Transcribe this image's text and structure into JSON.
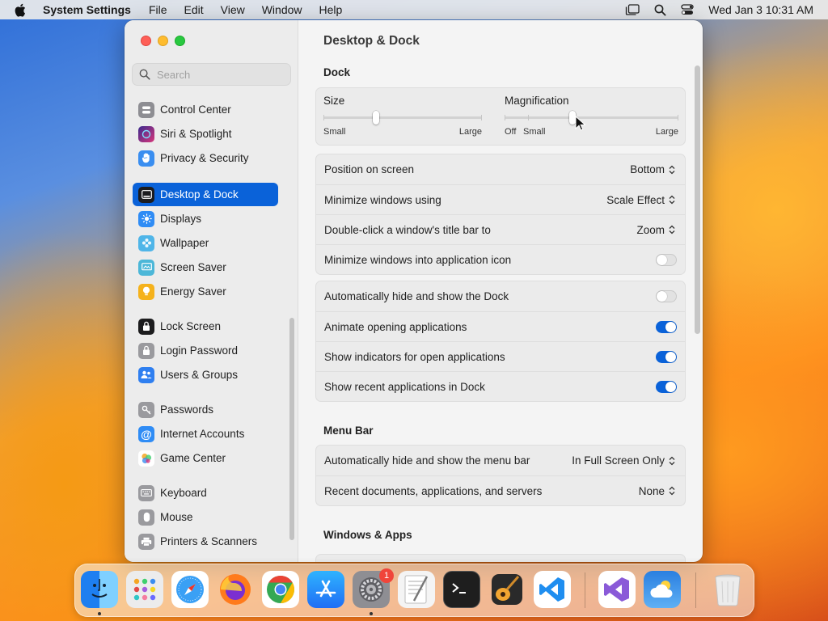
{
  "menubar": {
    "app_name": "System Settings",
    "menus": [
      "File",
      "Edit",
      "View",
      "Window",
      "Help"
    ],
    "clock": "Wed Jan 3  10:31 AM"
  },
  "window": {
    "title": "Desktop & Dock",
    "search_placeholder": "Search"
  },
  "sidebar": {
    "items": [
      {
        "label": "Control Center",
        "icon": "control-center-icon",
        "color": "#8e8e93"
      },
      {
        "label": "Siri & Spotlight",
        "icon": "siri-icon",
        "color": "#7a3be0"
      },
      {
        "label": "Privacy & Security",
        "icon": "hand-icon",
        "color": "#3a8ef0"
      },
      {
        "label": "Desktop & Dock",
        "icon": "dock-icon",
        "color": "#1c1c1e",
        "selected": true
      },
      {
        "label": "Displays",
        "icon": "sun-icon",
        "color": "#2f8cf5"
      },
      {
        "label": "Wallpaper",
        "icon": "wallpaper-icon",
        "color": "#4fb5e8"
      },
      {
        "label": "Screen Saver",
        "icon": "screen-saver-icon",
        "color": "#4cb7d8"
      },
      {
        "label": "Energy Saver",
        "icon": "bulb-icon",
        "color": "#f5b21c"
      },
      {
        "label": "Lock Screen",
        "icon": "lock-icon",
        "color": "#1c1c1e"
      },
      {
        "label": "Login Password",
        "icon": "lock-icon",
        "color": "#9a9a9e"
      },
      {
        "label": "Users & Groups",
        "icon": "users-icon",
        "color": "#2f7ff0"
      },
      {
        "label": "Passwords",
        "icon": "key-icon",
        "color": "#9a9a9e"
      },
      {
        "label": "Internet Accounts",
        "icon": "at-icon",
        "color": "#2f8cf5"
      },
      {
        "label": "Game Center",
        "icon": "game-center-icon",
        "color": "#ffffff"
      },
      {
        "label": "Keyboard",
        "icon": "keyboard-icon",
        "color": "#9a9a9e"
      },
      {
        "label": "Mouse",
        "icon": "mouse-icon",
        "color": "#9a9a9e"
      },
      {
        "label": "Printers & Scanners",
        "icon": "printer-icon",
        "color": "#9a9a9e"
      }
    ]
  },
  "dock_section": {
    "title": "Dock",
    "size": {
      "label": "Size",
      "min": "Small",
      "max": "Large",
      "value": 0.33
    },
    "magnification": {
      "label": "Magnification",
      "off": "Off",
      "min": "Small",
      "max": "Large",
      "value": 0.39
    },
    "rows1": [
      {
        "label": "Position on screen",
        "value": "Bottom"
      },
      {
        "label": "Minimize windows using",
        "value": "Scale Effect"
      },
      {
        "label": "Double-click a window's title bar to",
        "value": "Zoom"
      },
      {
        "label": "Minimize windows into application icon",
        "toggle": false
      }
    ],
    "rows2": [
      {
        "label": "Automatically hide and show the Dock",
        "toggle": false
      },
      {
        "label": "Animate opening applications",
        "toggle": true
      },
      {
        "label": "Show indicators for open applications",
        "toggle": true
      },
      {
        "label": "Show recent applications in Dock",
        "toggle": true
      }
    ]
  },
  "menubar_section": {
    "title": "Menu Bar",
    "rows": [
      {
        "label": "Automatically hide and show the menu bar",
        "value": "In Full Screen Only"
      },
      {
        "label": "Recent documents, applications, and servers",
        "value": "None"
      }
    ]
  },
  "windows_section": {
    "title": "Windows & Apps"
  },
  "dock": {
    "settings_badge": "1",
    "apps": [
      {
        "name": "finder",
        "color": "#2d8ff0"
      },
      {
        "name": "launchpad",
        "color": "#e8e8e8"
      },
      {
        "name": "safari",
        "color": "#3aa0f5"
      },
      {
        "name": "firefox",
        "color": "#ff7b1c"
      },
      {
        "name": "chrome",
        "color": "#ffffff"
      },
      {
        "name": "app-store",
        "color": "#1f8ef5"
      },
      {
        "name": "system-settings",
        "color": "#8e8e93"
      },
      {
        "name": "textedit",
        "color": "#f2f2f2"
      },
      {
        "name": "terminal",
        "color": "#1e1e1e"
      },
      {
        "name": "garageband",
        "color": "#f2a531"
      },
      {
        "name": "vscode",
        "color": "#ffffff"
      },
      {
        "name": "visual-studio",
        "color": "#ffffff"
      },
      {
        "name": "weather",
        "color": "#2a7fe0"
      },
      {
        "name": "trash",
        "color": "#e6e6e6"
      }
    ]
  }
}
